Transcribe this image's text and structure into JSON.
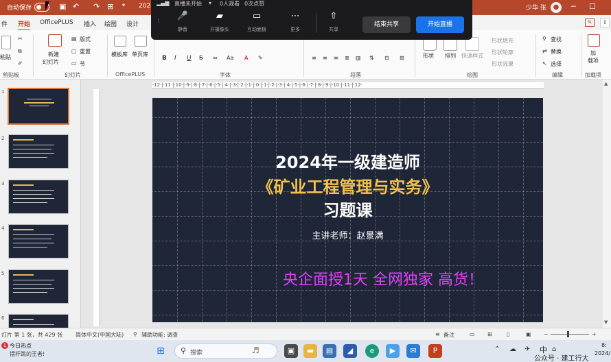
{
  "titlebar": {
    "autosave_label": "自动保存",
    "doc_title": "2024",
    "user_name": "少华 张"
  },
  "tabs": [
    "件",
    "开始",
    "OfficePLUS",
    "插入",
    "绘图",
    "设计"
  ],
  "ribbon": {
    "clipboard": {
      "paste": "粘贴",
      "label": "剪贴板"
    },
    "slides": {
      "new_slide": "新建",
      "new_slide2": "幻灯片",
      "layout": "版式",
      "reset": "重置",
      "section": "节",
      "label": "幻灯片"
    },
    "officeplus": {
      "template": "模板库",
      "single_page": "单页库",
      "label": "OfficePLUS"
    },
    "font": {
      "bold": "B",
      "italic": "I",
      "label": "字体"
    },
    "paragraph": {
      "label": "段落"
    },
    "drawing": {
      "shape": "形状",
      "arrange": "排列",
      "quick_styles": "快速样式",
      "shape_fill": "形状填充",
      "shape_outline": "形状轮廓",
      "shape_effects": "形状效果",
      "label": "绘图"
    },
    "editing": {
      "find": "查找",
      "replace": "替换",
      "select": "选择",
      "label": "编辑"
    },
    "addins": {
      "load": "加",
      "load2": "载项",
      "label": "加载项"
    }
  },
  "meeting": {
    "status": "直播未开始",
    "viewers": "0人观看",
    "likes": "0次点赞",
    "mute": "静音",
    "camera": "开摄像头",
    "interact": "互动面板",
    "more": "更多",
    "share": "共享",
    "end_share": "结束共享",
    "start_live": "开始直播",
    "end_share_color": "#3a3a3c",
    "start_live_color": "#1a73e8"
  },
  "slide": {
    "line1": "2024年一级建造师",
    "line2": "《矿业工程管理与实务》",
    "line3": "习题课",
    "teacher": "主讲老师：赵景满",
    "promo": "央企面授1天 全网独家 高货！",
    "title_color": "#ffffff",
    "highlight_color": "#f2c14e",
    "promo_color": "#e040fb"
  },
  "ruler": "·12·|·11·|·10·|·9·|·8·|·7·|·6·|·5·|·4·|·3·|·2·|·1·|·0·|·1·|·2·|·3·|·4·|·5·|·6·|·7·|·8·|·9·|·10·|·11·|·12·",
  "thumbnails": [
    "1",
    "2",
    "3",
    "4",
    "5",
    "6"
  ],
  "statusbar": {
    "slide_info": "灯片 第 1 张，共 429 张",
    "language": "简体中文(中国大陆)",
    "accessibility": "辅助功能: 调查",
    "notes": "备注"
  },
  "taskbar": {
    "search_placeholder": "搜索",
    "news_title": "今日热点",
    "news_sub": "摆杆跳的王者!",
    "ime": "中",
    "watermark": "公众号 · 建工行大",
    "time": "8:",
    "date": "2024/"
  }
}
